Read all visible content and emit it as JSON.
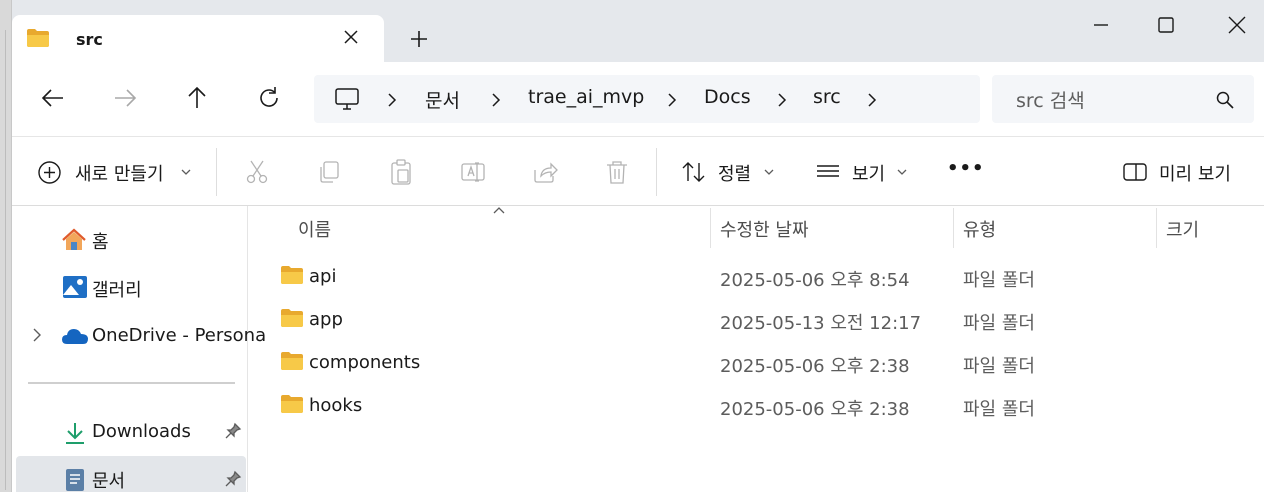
{
  "window": {
    "tab_title": "src",
    "tab_icon": "folder-icon",
    "new_tab_symbol": "+",
    "controls": [
      "minimize-icon",
      "maximize-icon",
      "close-icon"
    ]
  },
  "nav": {
    "buttons": [
      "back-arrow-icon",
      "forward-arrow-icon",
      "up-arrow-icon",
      "refresh-icon"
    ]
  },
  "breadcrumb": {
    "root_icon": "this-pc-icon",
    "items": [
      "문서",
      "trae_ai_mvp",
      "Docs",
      "src"
    ]
  },
  "search": {
    "placeholder": "src 검색",
    "icon": "search-icon"
  },
  "commandbar": {
    "new_label": "새로 만들기",
    "sort_label": "정렬",
    "view_label": "보기",
    "more_symbol": "•••",
    "preview_label": "미리 보기",
    "icons": [
      "cut-icon",
      "copy-icon",
      "paste-icon",
      "rename-icon",
      "share-icon",
      "delete-icon"
    ]
  },
  "sidebar": {
    "items": [
      {
        "label": "홈",
        "icon": "home-icon"
      },
      {
        "label": "갤러리",
        "icon": "gallery-icon"
      },
      {
        "label": "OneDrive - Persona",
        "icon": "onedrive-cloud-icon"
      },
      {
        "label": "Downloads",
        "icon": "download-icon",
        "pinned": true
      },
      {
        "label": "문서",
        "icon": "documents-icon",
        "pinned": true,
        "selected": true
      }
    ]
  },
  "list": {
    "columns": [
      "이름",
      "수정한 날짜",
      "유형",
      "크기"
    ],
    "rows": [
      {
        "name": "api",
        "date": "2025-05-06 오후 8:54",
        "type": "파일 폴더"
      },
      {
        "name": "app",
        "date": "2025-05-13 오전 12:17",
        "type": "파일 폴더"
      },
      {
        "name": "components",
        "date": "2025-05-06 오후 2:38",
        "type": "파일 폴더"
      },
      {
        "name": "hooks",
        "date": "2025-05-06 오후 2:38",
        "type": "파일 폴더"
      }
    ]
  },
  "colors": {
    "folder": "#f2c14e",
    "accent": "#0067c0",
    "titlebar": "#e5e8ec",
    "selection": "#e3e6ea"
  }
}
